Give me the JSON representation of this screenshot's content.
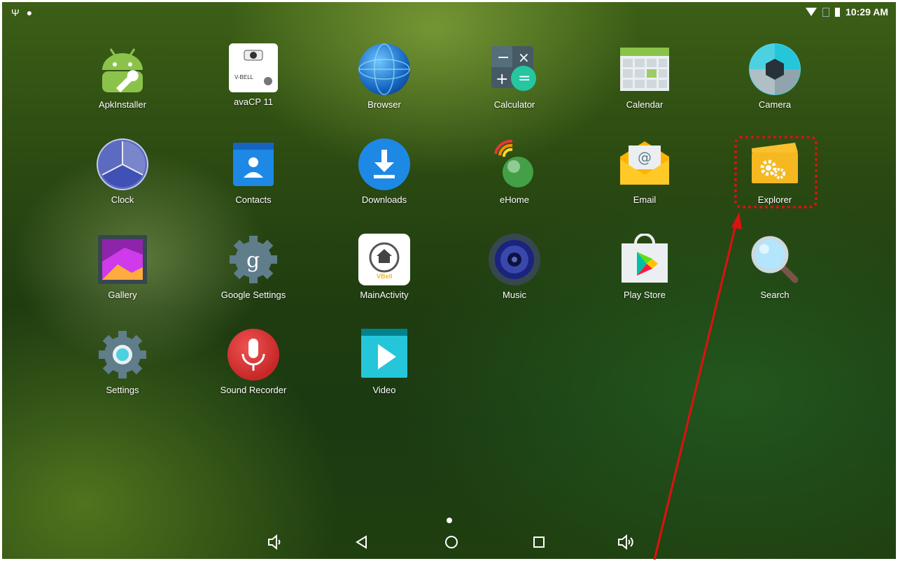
{
  "status_bar": {
    "time": "10:29 AM"
  },
  "apps": [
    {
      "label": "ApkInstaller",
      "icon": "android-wrench-icon"
    },
    {
      "label": "avaCP 11",
      "icon": "vbell-device-icon"
    },
    {
      "label": "Browser",
      "icon": "globe-icon"
    },
    {
      "label": "Calculator",
      "icon": "calculator-icon"
    },
    {
      "label": "Calendar",
      "icon": "calendar-icon"
    },
    {
      "label": "Camera",
      "icon": "camera-shutter-icon"
    },
    {
      "label": "Clock",
      "icon": "clock-icon"
    },
    {
      "label": "Contacts",
      "icon": "contacts-icon"
    },
    {
      "label": "Downloads",
      "icon": "download-icon"
    },
    {
      "label": "eHome",
      "icon": "ehome-icon"
    },
    {
      "label": "Email",
      "icon": "email-icon"
    },
    {
      "label": "Explorer",
      "icon": "folder-gear-icon"
    },
    {
      "label": "Gallery",
      "icon": "gallery-icon"
    },
    {
      "label": "Google Settings",
      "icon": "google-settings-icon"
    },
    {
      "label": "MainActivity",
      "icon": "vbell-home-icon"
    },
    {
      "label": "Music",
      "icon": "speaker-icon"
    },
    {
      "label": "Play Store",
      "icon": "play-store-icon"
    },
    {
      "label": "Search",
      "icon": "magnifier-icon"
    },
    {
      "label": "Settings",
      "icon": "settings-gear-icon"
    },
    {
      "label": "Sound Recorder",
      "icon": "microphone-icon"
    },
    {
      "label": "Video",
      "icon": "video-play-icon"
    }
  ],
  "icon_text": {
    "avacp_brand": "V-BELL",
    "vbell_brand": "VBell",
    "email_glyph": "@",
    "google_glyph": "g"
  },
  "nav_bar": {
    "volume_down": "volume-down-icon",
    "back": "back-icon",
    "home": "home-icon",
    "recents": "recents-icon",
    "volume_up": "volume-up-icon"
  },
  "annotation": {
    "highlighted_app": "Explorer",
    "color": "#e01010"
  },
  "colors": {
    "accent_red": "#e01010",
    "download_blue": "#1e88e5",
    "explorer_yellow": "#f5b820"
  }
}
